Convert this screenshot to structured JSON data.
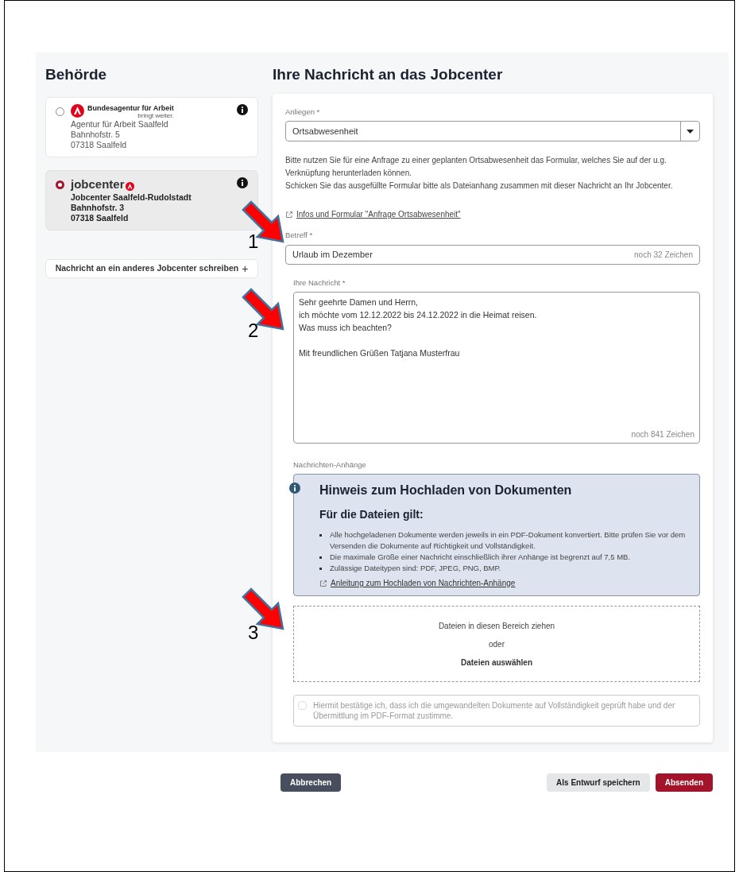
{
  "sidebar": {
    "title": "Behörde",
    "authorities": [
      {
        "kind": "agentur",
        "logo_text": "Bundesagentur für Arbeit",
        "logo_tagline": "bringt weiter.",
        "lines": [
          "Agentur für Arbeit Saalfeld",
          "Bahnhofstr. 5",
          "07318 Saalfeld"
        ],
        "selected": false
      },
      {
        "kind": "jobcenter",
        "logo_text": "jobcenter",
        "lines": [
          "Jobcenter Saalfeld-Rudolstadt",
          "Bahnhofstr. 3",
          "07318 Saalfeld"
        ],
        "selected": true
      }
    ],
    "other_button": "Nachricht an ein anderes Jobcenter schreiben",
    "other_button_icon": "+"
  },
  "form": {
    "title": "Ihre Nachricht an das Jobcenter",
    "concern": {
      "label": "Anliegen *",
      "value": "Ortsabwesenheit"
    },
    "info_paragraphs": [
      "Bitte nutzen Sie für eine Anfrage zu einer geplanten Ortsabwesenheit das Formular, welches Sie auf der u.g. Verknüpfung herunterladen können.",
      "Schicken Sie das ausgefüllte Formular bitte als Dateianhang zusammen mit dieser Nachricht an Ihr Jobcenter."
    ],
    "info_link": "Infos und Formular \"Anfrage Ortsabwesenheit\"",
    "subject": {
      "label": "Betreff *",
      "value": "Urlaub im Dezember",
      "counter": "noch 32 Zeichen"
    },
    "message": {
      "label": "Ihre Nachricht *",
      "paragraphs": [
        [
          "Sehr geehrte Damen und Herrn,",
          "ich möchte vom 12.12.2022 bis 24.12.2022 in die Heimat reisen.",
          "Was muss ich beachten?"
        ],
        [
          "Mit freundlichen Grüßen Tatjana Musterfrau"
        ]
      ],
      "counter": "noch 841 Zeichen"
    },
    "attachments": {
      "label": "Nachrichten-Anhänge",
      "notice": {
        "title": "Hinweis zum Hochladen von Dokumenten",
        "subtitle": "Für die Dateien gilt:",
        "bullets": [
          "Alle hochgeladenen Dokumente werden jeweils in ein PDF-Dokument konvertiert. Bitte prüfen Sie vor dem Versenden die Dokumente auf Richtigkeit und Vollständigkeit.",
          "Die maximale Größe einer Nachricht einschließlich ihrer Anhänge ist begrenzt auf 7,5 MB.",
          "Zulässige Dateitypen sind: PDF, JPEG, PNG, BMP."
        ],
        "link": "Anleitung zum Hochladen von Nachrichten-Anhänge"
      },
      "dropzone": {
        "hint": "Dateien in diesen Bereich ziehen",
        "or": "oder",
        "choose": "Dateien auswählen"
      }
    },
    "confirm": {
      "label": "Hiermit bestätige ich, dass ich die umgewandelten Dokumente auf Vollständigkeit geprüft habe und der Übermittlung im PDF-Format zustimme.",
      "checked": false,
      "disabled": true
    }
  },
  "buttons": {
    "cancel": "Abbrechen",
    "draft": "Als Entwurf speichern",
    "send": "Absenden"
  },
  "annotations": [
    {
      "number": "1",
      "kind": "subject"
    },
    {
      "number": "2",
      "kind": "message"
    },
    {
      "number": "3",
      "kind": "dropzone"
    }
  ]
}
